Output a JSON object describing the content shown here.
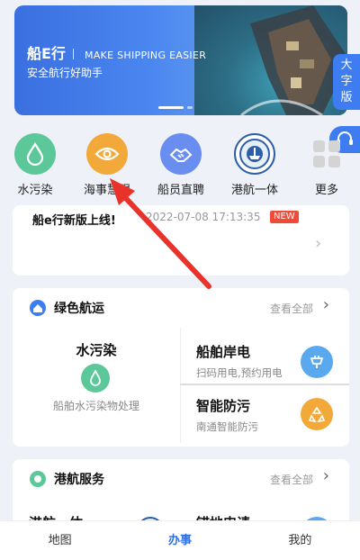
{
  "banner": {
    "title": "船E行",
    "subtitle": "MAKE SHIPPING EASIER",
    "slogan": "安全航行好助手"
  },
  "side_tab": {
    "label": "大字版"
  },
  "quick_icons": [
    {
      "label": "水污染",
      "icon": "water-drop-icon",
      "color": "#5cc89a"
    },
    {
      "label": "海事慧眼",
      "icon": "eye-icon",
      "color": "#f2a93a"
    },
    {
      "label": "船员直聘",
      "icon": "handshake-icon",
      "color": "#6a8ef0"
    },
    {
      "label": "港航一体",
      "icon": "port-emblem-icon",
      "color": "#2d5ea8"
    },
    {
      "label": "更多",
      "icon": "grid-icon",
      "color": "#cccccc"
    }
  ],
  "notice": {
    "title": "船e行新版上线!",
    "time": "2022-07-08 17:13:35",
    "badge": "NEW"
  },
  "green_shipping": {
    "title": "绿色航运",
    "more": "查看全部",
    "left": {
      "title": "水污染",
      "desc": "船舶水污染物处理"
    },
    "items": [
      {
        "title": "船舶岸电",
        "desc": "扫码用电,预约用电"
      },
      {
        "title": "智能防污",
        "desc": "南通智能防污"
      }
    ]
  },
  "port_service": {
    "title": "港航服务",
    "more": "查看全部",
    "items": [
      {
        "title": "港航一体"
      },
      {
        "title": "锚地申请"
      }
    ]
  },
  "nav": [
    {
      "label": "地图"
    },
    {
      "label": "办事"
    },
    {
      "label": "我的"
    }
  ],
  "colors": {
    "accent": "#2f6fea",
    "banner": "#3d7cf1",
    "badge": "#f04b3a",
    "arrow": "#e8322a"
  }
}
